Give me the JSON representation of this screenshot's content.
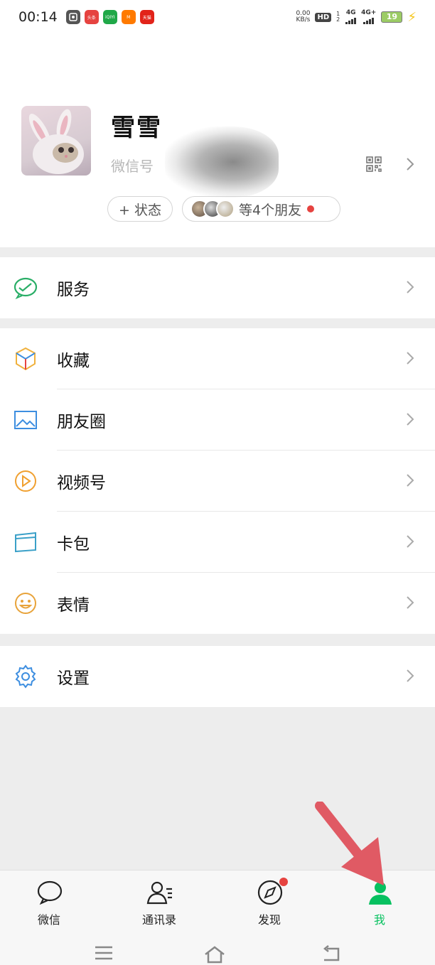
{
  "status_bar": {
    "time": "00:14",
    "speed_value": "0.00",
    "speed_unit": "KB/s",
    "hd_label": "HD",
    "hd_sub": "1 2",
    "sim1": "4G",
    "sim2": "4G+",
    "battery": "19",
    "apps": [
      {
        "name": "toutiao",
        "text": "头条",
        "color": "#e64340"
      },
      {
        "name": "iqiyi",
        "text": "iQIYI",
        "color": "#20a848"
      },
      {
        "name": "mango",
        "text": "M",
        "color": "#ff7a00"
      },
      {
        "name": "taobao",
        "text": "天猫",
        "color": "#e2231a"
      }
    ]
  },
  "profile": {
    "nickname": "雪雪",
    "wechat_id_label": "微信号",
    "status_button": "+ 状态",
    "friends_text": "等4个朋友"
  },
  "menu": {
    "services": "服务",
    "favorites": "收藏",
    "moments": "朋友圈",
    "channels": "视频号",
    "cards": "卡包",
    "stickers": "表情",
    "settings": "设置"
  },
  "tabbar": {
    "chats": "微信",
    "contacts": "通讯录",
    "discover": "发现",
    "me": "我"
  },
  "colors": {
    "accent": "#07c160",
    "badge": "#e64340",
    "annotation_arrow": "#e05a64"
  }
}
